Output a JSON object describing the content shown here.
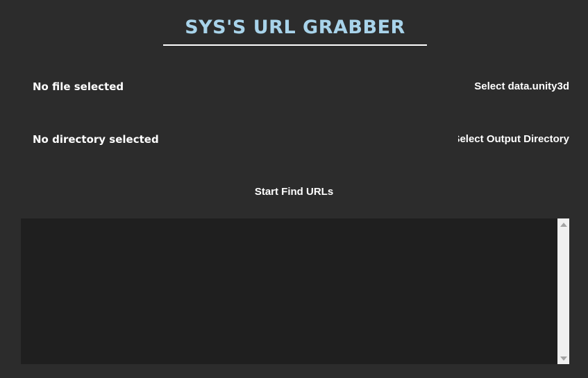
{
  "app": {
    "title": "SYS'S URL GRABBER"
  },
  "file_row": {
    "status": "No file selected",
    "button_label": "Select data.unity3d"
  },
  "dir_row": {
    "status": "No directory selected",
    "button_label": "Select Output Directory"
  },
  "actions": {
    "start_label": "Start Find URLs"
  },
  "output": {
    "text": ""
  },
  "colors": {
    "background": "#2c2c2c",
    "title": "#a8d3ea",
    "output_bg": "#1f1f1f",
    "scrollbar": "#f0f0f0"
  },
  "icons": {
    "scroll_up": "scroll-up-arrow-icon",
    "scroll_down": "scroll-down-arrow-icon"
  }
}
